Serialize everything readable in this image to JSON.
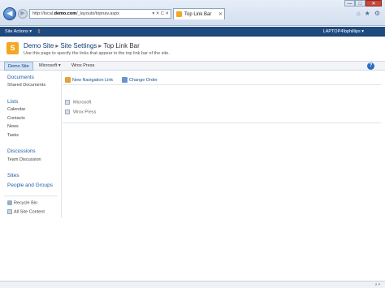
{
  "browser": {
    "address_text_pre": "http://local.",
    "address_text_bold": "demo.com",
    "address_text_post": "/_layouts/topnav.aspx",
    "address_controls": "▾ ✕ C ✕",
    "tab_title": "Top Link Bar",
    "window_buttons": [
      "—",
      "□",
      "✕"
    ],
    "tools": [
      "⌂",
      "★",
      "⚙"
    ]
  },
  "ribbon": {
    "site_actions": "Site Actions ▾",
    "user": "LAPTOP4\\bphillips ▾"
  },
  "title_area": {
    "breadcrumb": [
      "Demo Site",
      "Site Settings",
      "Top Link Bar"
    ],
    "separator": "▸",
    "description": "Use this page to specify the links that appear in the top link bar of the site."
  },
  "topnav": {
    "items": [
      "Demo Site",
      "Microsoft ▾",
      "Wrox Press"
    ],
    "help": "?"
  },
  "quicklaunch": {
    "documents_heading": "Documents",
    "documents_links": [
      "Shared Documents"
    ],
    "lists_heading": "Lists",
    "lists_links": [
      "Calendar",
      "Contacts",
      "News",
      "Tasks"
    ],
    "discussions_heading": "Discussions",
    "discussions_links": [
      "Team Discussion"
    ],
    "sites_heading": "Sites",
    "people_heading": "People and Groups",
    "recycle_bin": "Recycle Bin",
    "all_content": "All Site Content"
  },
  "toolbar": {
    "new_link": "New Navigation Link",
    "change_order": "Change Order"
  },
  "links": [
    "Microsoft",
    "Wrox Press"
  ]
}
